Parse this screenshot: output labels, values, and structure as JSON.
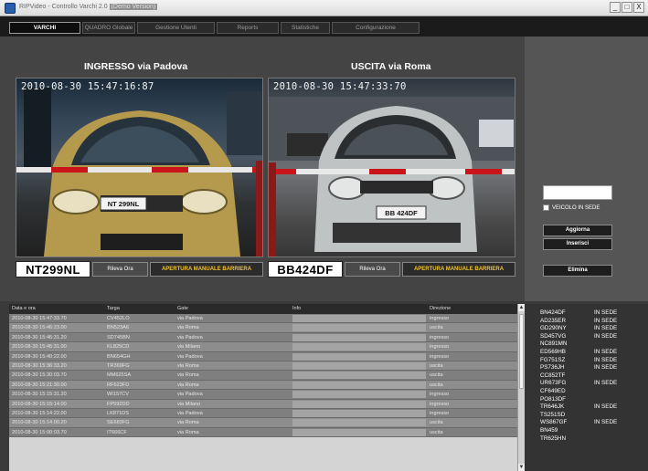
{
  "window": {
    "title_prefix": "RIPVideo - Controllo Varchi 2.0",
    "title_highlight": "(Demo Version)",
    "buttons": [
      "_",
      "□",
      "X"
    ]
  },
  "tabs": [
    {
      "label": "VARCHI",
      "active": true
    },
    {
      "label": "QUADRO Globale",
      "active": false
    },
    {
      "label": "Gestione Utenti",
      "active": false
    },
    {
      "label": "Reports",
      "active": false
    },
    {
      "label": "Statistiche",
      "active": false
    },
    {
      "label": "Configurazione",
      "active": false
    }
  ],
  "entrance": {
    "title": "INGRESSO via Padova",
    "timestamp": "2010-08-30 15:47:16:87",
    "plate": "NT299NL",
    "car_plate": "NT 299NL",
    "record_button": "Rileva Ora",
    "barrier_button": "APERTURA MANUALE BARRIERA"
  },
  "exit": {
    "title": "USCITA via Roma",
    "timestamp": "2010-08-30 15:47:33:70",
    "plate": "BB424DF",
    "car_plate": "BB 424DF",
    "record_button": "Rileva Ora",
    "barrier_button": "APERTURA MANUALE BARRIERA"
  },
  "side_panel": {
    "checkbox_label": "VEICOLO IN SEDE",
    "buttons": {
      "update": "Aggiorna",
      "insert": "Inserisci",
      "delete": "Elimina"
    }
  },
  "table": {
    "columns": [
      "Data e ora",
      "Targa",
      "Gate",
      "Info",
      "Direzione"
    ],
    "rows": [
      [
        "2010-08-30 15:47:33.70",
        "CV452LO",
        "via Padova",
        "",
        "ingresso"
      ],
      [
        "2010-08-30 15:46:23.00",
        "BN523A6",
        "via Roma",
        "",
        "uscita"
      ],
      [
        "2010-08-30 15:46:31.20",
        "SD745BN",
        "via Padova",
        "",
        "ingresso"
      ],
      [
        "2010-08-30 15:45:31.00",
        "KL825CD",
        "via Milano",
        "",
        "ingresso"
      ],
      [
        "2010-08-30 15:40:22.00",
        "BN654GH",
        "via Padova",
        "",
        "ingresso"
      ],
      [
        "2010-08-30 15:36:33.20",
        "TR369FG",
        "via Roma",
        "",
        "uscita"
      ],
      [
        "2010-08-30 15:30:03.70",
        "MM625SA",
        "via Roma",
        "",
        "uscita"
      ],
      [
        "2010-08-30 15:21:30.00",
        "RF623FD",
        "via Roma",
        "",
        "uscita"
      ],
      [
        "2010-08-30 15:15:31.20",
        "WI157CV",
        "via Padova",
        "",
        "ingresso"
      ],
      [
        "2010-08-30 15:15:14.00",
        "FP592DD",
        "via Milano",
        "",
        "ingresso"
      ],
      [
        "2010-08-30 15:14:22.00",
        "LK871DS",
        "via Padova",
        "",
        "ingresso"
      ],
      [
        "2010-08-30 15:14:00.20",
        "SE683FG",
        "via Roma",
        "",
        "uscita"
      ],
      [
        "2010-08-30 15:00:03.70",
        "IT666CF",
        "via Roma",
        "",
        "uscita"
      ]
    ]
  },
  "vehicles": [
    {
      "plate": "BN424DF",
      "status": "IN SEDE"
    },
    {
      "plate": "AD235ER",
      "status": "IN SEDE"
    },
    {
      "plate": "GD290NY",
      "status": "IN SEDE"
    },
    {
      "plate": "SD457VG",
      "status": "IN SEDE"
    },
    {
      "plate": "NC891MN",
      "status": ""
    },
    {
      "plate": "ED569HB",
      "status": "IN SEDE"
    },
    {
      "plate": "FG751SZ",
      "status": "IN SEDE"
    },
    {
      "plate": "PS736JH",
      "status": "IN SEDE"
    },
    {
      "plate": "CC852TF",
      "status": ""
    },
    {
      "plate": "UR673FG",
      "status": "IN SEDE"
    },
    {
      "plate": "CF649ED",
      "status": ""
    },
    {
      "plate": "PO813DF",
      "status": ""
    },
    {
      "plate": "TR646JK",
      "status": "IN SEDE"
    },
    {
      "plate": "TS251SD",
      "status": ""
    },
    {
      "plate": "WS867GF",
      "status": "IN SEDE"
    },
    {
      "plate": "BN459",
      "status": ""
    },
    {
      "plate": "TR625HN",
      "status": ""
    }
  ],
  "colors": {
    "background": "#3a3a3a",
    "barrier_text": "#f1c232",
    "barrier_red": "#c9141a"
  },
  "icons": {
    "app": "app-icon",
    "scroll_up": "scroll-up-icon",
    "scroll_down": "scroll-down-icon"
  }
}
